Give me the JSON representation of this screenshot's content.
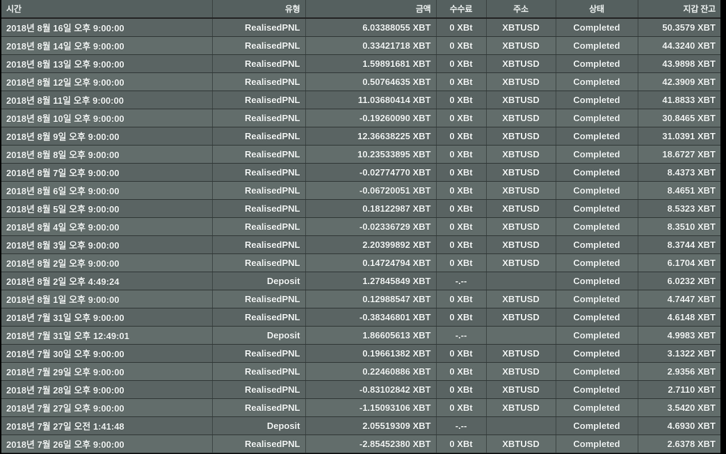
{
  "table": {
    "columns": [
      {
        "key": "time",
        "label": "시간",
        "align": "l"
      },
      {
        "key": "type",
        "label": "유형",
        "align": "r"
      },
      {
        "key": "amount",
        "label": "금액",
        "align": "r"
      },
      {
        "key": "fee",
        "label": "수수료",
        "align": "c"
      },
      {
        "key": "address",
        "label": "주소",
        "align": "c"
      },
      {
        "key": "status",
        "label": "상태",
        "align": "c"
      },
      {
        "key": "balance",
        "label": "지갑 잔고",
        "align": "r"
      }
    ],
    "rows": [
      {
        "time": "2018년 8월 16일 오후 9:00:00",
        "type": "RealisedPNL",
        "amount": "6.03388055 XBT",
        "fee": "0 XBt",
        "address": "XBTUSD",
        "status": "Completed",
        "balance": "50.3579 XBT"
      },
      {
        "time": "2018년 8월 14일 오후 9:00:00",
        "type": "RealisedPNL",
        "amount": "0.33421718 XBT",
        "fee": "0 XBt",
        "address": "XBTUSD",
        "status": "Completed",
        "balance": "44.3240 XBT"
      },
      {
        "time": "2018년 8월 13일 오후 9:00:00",
        "type": "RealisedPNL",
        "amount": "1.59891681 XBT",
        "fee": "0 XBt",
        "address": "XBTUSD",
        "status": "Completed",
        "balance": "43.9898 XBT"
      },
      {
        "time": "2018년 8월 12일 오후 9:00:00",
        "type": "RealisedPNL",
        "amount": "0.50764635 XBT",
        "fee": "0 XBt",
        "address": "XBTUSD",
        "status": "Completed",
        "balance": "42.3909 XBT"
      },
      {
        "time": "2018년 8월 11일 오후 9:00:00",
        "type": "RealisedPNL",
        "amount": "11.03680414 XBT",
        "fee": "0 XBt",
        "address": "XBTUSD",
        "status": "Completed",
        "balance": "41.8833 XBT"
      },
      {
        "time": "2018년 8월 10일 오후 9:00:00",
        "type": "RealisedPNL",
        "amount": "-0.19260090 XBT",
        "fee": "0 XBt",
        "address": "XBTUSD",
        "status": "Completed",
        "balance": "30.8465 XBT"
      },
      {
        "time": "2018년 8월 9일 오후 9:00:00",
        "type": "RealisedPNL",
        "amount": "12.36638225 XBT",
        "fee": "0 XBt",
        "address": "XBTUSD",
        "status": "Completed",
        "balance": "31.0391 XBT"
      },
      {
        "time": "2018년 8월 8일 오후 9:00:00",
        "type": "RealisedPNL",
        "amount": "10.23533895 XBT",
        "fee": "0 XBt",
        "address": "XBTUSD",
        "status": "Completed",
        "balance": "18.6727 XBT"
      },
      {
        "time": "2018년 8월 7일 오후 9:00:00",
        "type": "RealisedPNL",
        "amount": "-0.02774770 XBT",
        "fee": "0 XBt",
        "address": "XBTUSD",
        "status": "Completed",
        "balance": "8.4373 XBT"
      },
      {
        "time": "2018년 8월 6일 오후 9:00:00",
        "type": "RealisedPNL",
        "amount": "-0.06720051 XBT",
        "fee": "0 XBt",
        "address": "XBTUSD",
        "status": "Completed",
        "balance": "8.4651 XBT"
      },
      {
        "time": "2018년 8월 5일 오후 9:00:00",
        "type": "RealisedPNL",
        "amount": "0.18122987 XBT",
        "fee": "0 XBt",
        "address": "XBTUSD",
        "status": "Completed",
        "balance": "8.5323 XBT"
      },
      {
        "time": "2018년 8월 4일 오후 9:00:00",
        "type": "RealisedPNL",
        "amount": "-0.02336729 XBT",
        "fee": "0 XBt",
        "address": "XBTUSD",
        "status": "Completed",
        "balance": "8.3510 XBT"
      },
      {
        "time": "2018년 8월 3일 오후 9:00:00",
        "type": "RealisedPNL",
        "amount": "2.20399892 XBT",
        "fee": "0 XBt",
        "address": "XBTUSD",
        "status": "Completed",
        "balance": "8.3744 XBT"
      },
      {
        "time": "2018년 8월 2일 오후 9:00:00",
        "type": "RealisedPNL",
        "amount": "0.14724794 XBT",
        "fee": "0 XBt",
        "address": "XBTUSD",
        "status": "Completed",
        "balance": "6.1704 XBT"
      },
      {
        "time": "2018년 8월 2일 오후 4:49:24",
        "type": "Deposit",
        "amount": "1.27845849 XBT",
        "fee": "-.--",
        "address": "",
        "status": "Completed",
        "balance": "6.0232 XBT"
      },
      {
        "time": "2018년 8월 1일 오후 9:00:00",
        "type": "RealisedPNL",
        "amount": "0.12988547 XBT",
        "fee": "0 XBt",
        "address": "XBTUSD",
        "status": "Completed",
        "balance": "4.7447 XBT"
      },
      {
        "time": "2018년 7월 31일 오후 9:00:00",
        "type": "RealisedPNL",
        "amount": "-0.38346801 XBT",
        "fee": "0 XBt",
        "address": "XBTUSD",
        "status": "Completed",
        "balance": "4.6148 XBT"
      },
      {
        "time": "2018년 7월 31일 오후 12:49:01",
        "type": "Deposit",
        "amount": "1.86605613 XBT",
        "fee": "-.--",
        "address": "",
        "status": "Completed",
        "balance": "4.9983 XBT"
      },
      {
        "time": "2018년 7월 30일 오후 9:00:00",
        "type": "RealisedPNL",
        "amount": "0.19661382 XBT",
        "fee": "0 XBt",
        "address": "XBTUSD",
        "status": "Completed",
        "balance": "3.1322 XBT"
      },
      {
        "time": "2018년 7월 29일 오후 9:00:00",
        "type": "RealisedPNL",
        "amount": "0.22460886 XBT",
        "fee": "0 XBt",
        "address": "XBTUSD",
        "status": "Completed",
        "balance": "2.9356 XBT"
      },
      {
        "time": "2018년 7월 28일 오후 9:00:00",
        "type": "RealisedPNL",
        "amount": "-0.83102842 XBT",
        "fee": "0 XBt",
        "address": "XBTUSD",
        "status": "Completed",
        "balance": "2.7110 XBT"
      },
      {
        "time": "2018년 7월 27일 오후 9:00:00",
        "type": "RealisedPNL",
        "amount": "-1.15093106 XBT",
        "fee": "0 XBt",
        "address": "XBTUSD",
        "status": "Completed",
        "balance": "3.5420 XBT"
      },
      {
        "time": "2018년 7월 27일 오전 1:41:48",
        "type": "Deposit",
        "amount": "2.05519309 XBT",
        "fee": "-.--",
        "address": "",
        "status": "Completed",
        "balance": "4.6930 XBT"
      },
      {
        "time": "2018년 7월 26일 오후 9:00:00",
        "type": "RealisedPNL",
        "amount": "-2.85452380 XBT",
        "fee": "0 XBt",
        "address": "XBTUSD",
        "status": "Completed",
        "balance": "2.6378 XBT"
      }
    ]
  },
  "colors": {
    "header_bg": "#55605f",
    "row_odd_bg": "#5a6463",
    "row_even_bg": "#626d6b",
    "text": "#f2f6f5",
    "page_bg": "#000000"
  }
}
